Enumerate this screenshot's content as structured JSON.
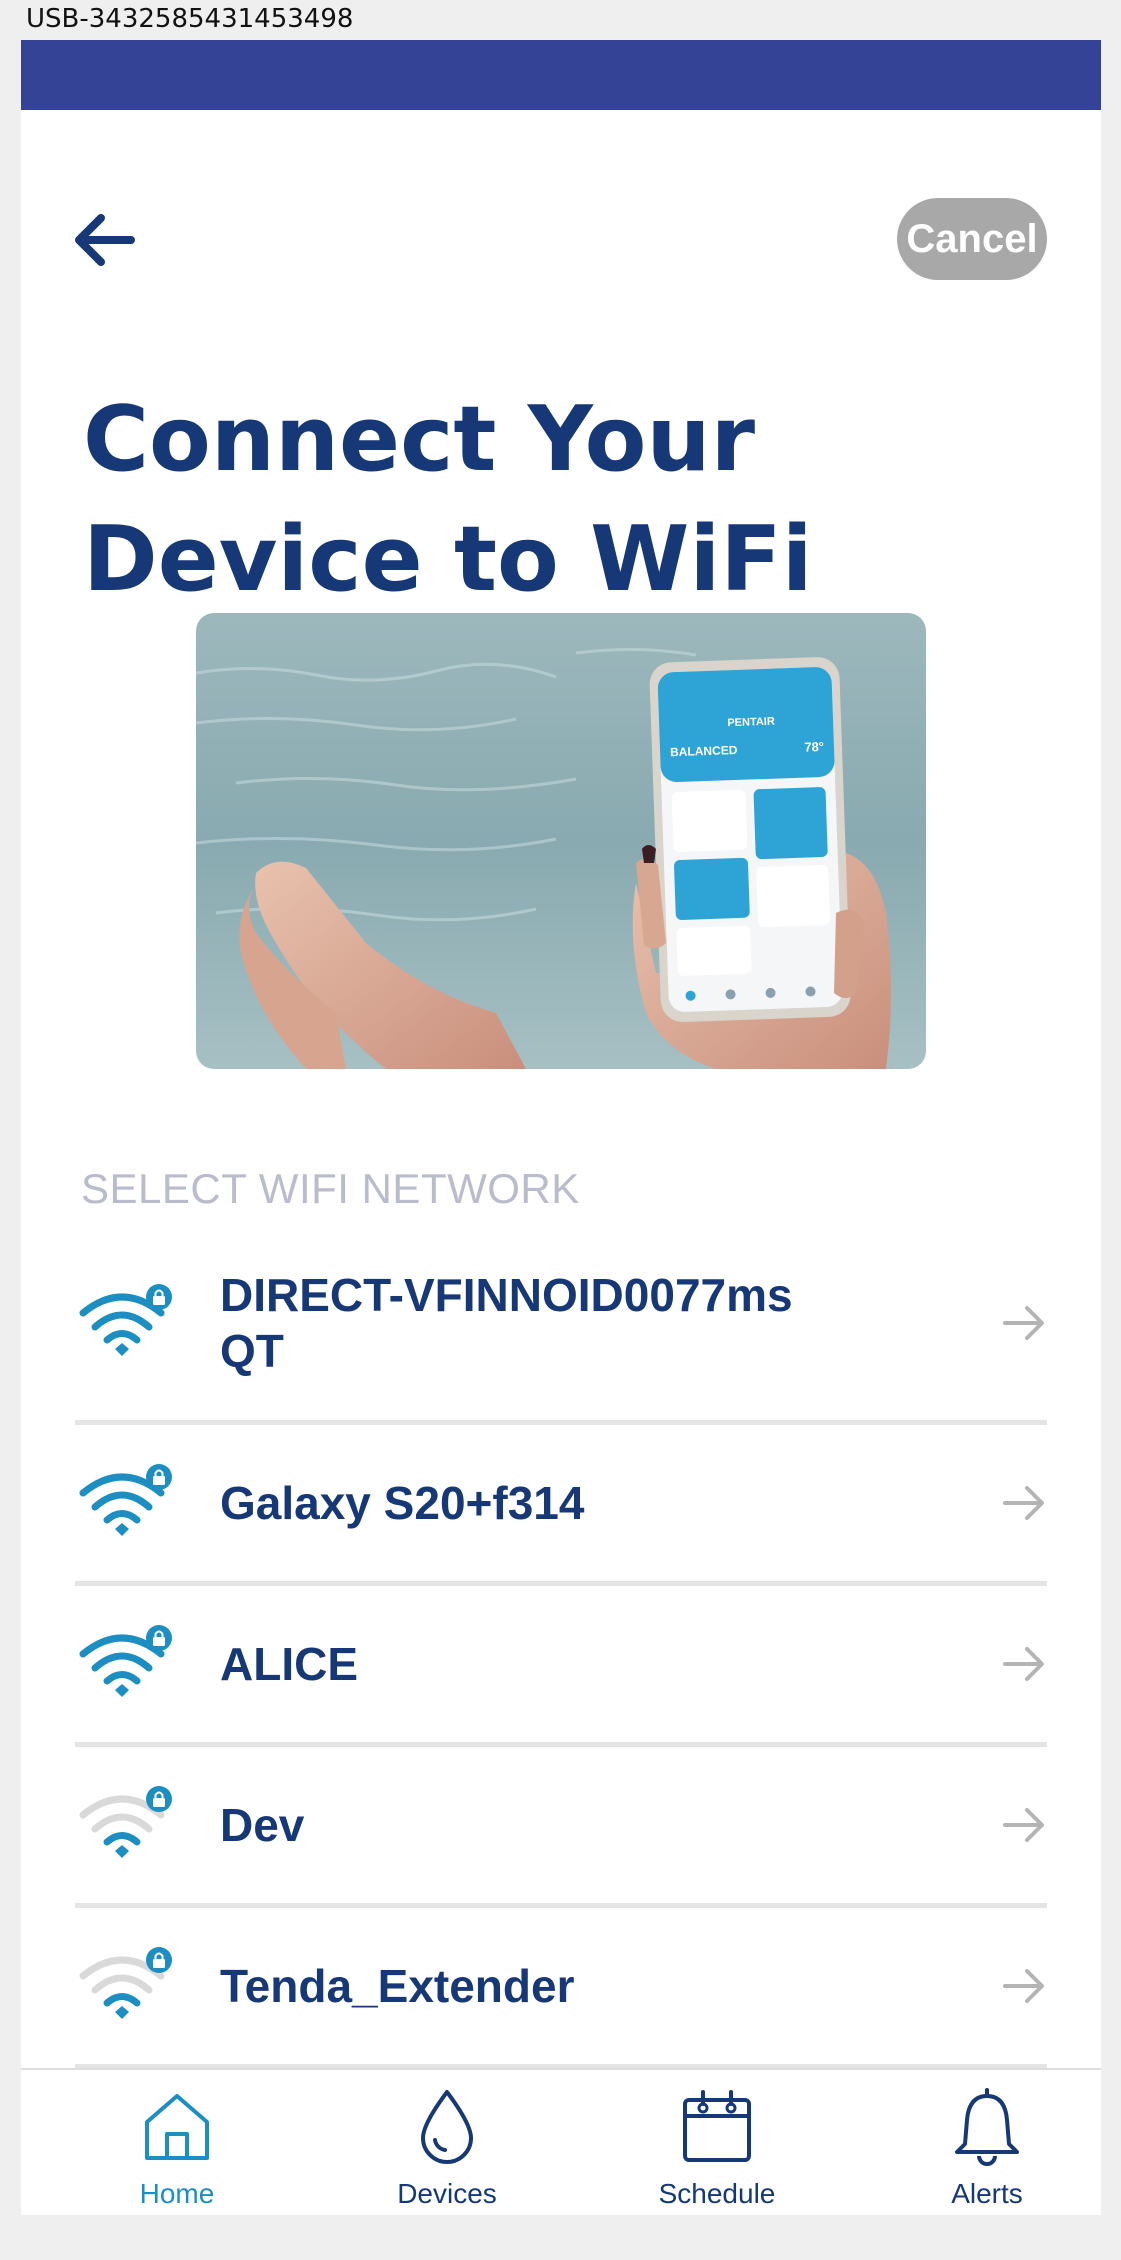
{
  "device_label": "USB-3432585431453498",
  "header": {
    "cancel_label": "Cancel"
  },
  "title": {
    "line1": "Connect Your",
    "line2": "Device to WiFi"
  },
  "hero": {
    "app_status_label": "BALANCED",
    "app_temp": "78°",
    "app_brand": "PENTAIR"
  },
  "section_label": "SELECT WIFI NETWORK",
  "networks": [
    {
      "name_line1": "DIRECT-VFINNOID0077ms",
      "name_line2": "QT",
      "signal_bars": 3,
      "secured": true
    },
    {
      "name_line1": "Galaxy S20+f314",
      "signal_bars": 3,
      "secured": true
    },
    {
      "name_line1": "ALICE",
      "signal_bars": 3,
      "secured": true
    },
    {
      "name_line1": "Dev",
      "signal_bars": 1,
      "secured": true
    },
    {
      "name_line1": "Tenda_Extender",
      "signal_bars": 1,
      "secured": true
    }
  ],
  "nav": [
    {
      "label": "Home",
      "icon": "home-icon",
      "active": true
    },
    {
      "label": "Devices",
      "icon": "droplet-icon",
      "active": false
    },
    {
      "label": "Schedule",
      "icon": "calendar-icon",
      "active": false
    },
    {
      "label": "Alerts",
      "icon": "bell-icon",
      "active": false
    }
  ],
  "colors": {
    "status_bar": "#354397",
    "title": "#173876",
    "wifi_active": "#1d8ec2",
    "wifi_inactive": "#d9d9d9",
    "cancel_bg": "#a8a8a8",
    "section_label": "#b9bccb"
  }
}
